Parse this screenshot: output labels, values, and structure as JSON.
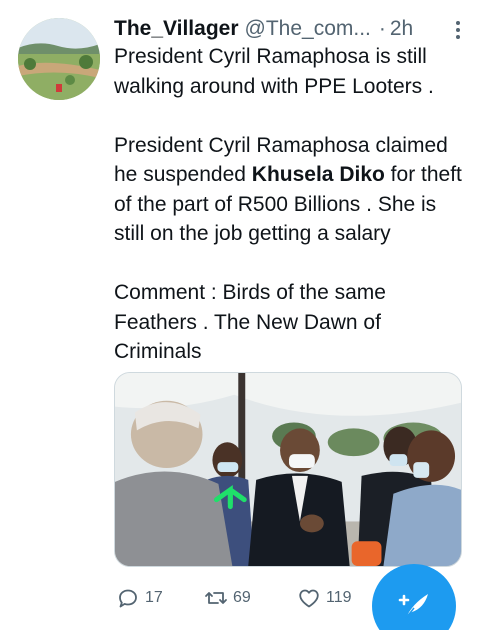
{
  "tweet": {
    "display_name": "The_Villager",
    "handle": "@The_com...",
    "separator": "·",
    "time": "2h",
    "text": {
      "line1": "President Cyril Ramaphosa is still walking around with PPE Looters .",
      "line2_prefix": "President Cyril Ramaphosa claimed he suspended ",
      "line2_bold": "Khusela Diko",
      "line2_suffix": " for theft of the part of R500 Billions . She is still on the job getting a salary",
      "line3": "Comment : Birds of the same Feathers . The New Dawn of Criminals"
    },
    "counts": {
      "replies": "17",
      "retweets": "69",
      "likes": "119"
    }
  },
  "icons": {
    "more": "more-vertical-icon",
    "reply": "reply-icon",
    "retweet": "retweet-icon",
    "like": "heart-icon",
    "compose": "compose-tweet-icon"
  },
  "colors": {
    "accent": "#1d9bf0",
    "muted": "#536471",
    "text": "#0f1419",
    "arrow": "#1fe06a"
  }
}
